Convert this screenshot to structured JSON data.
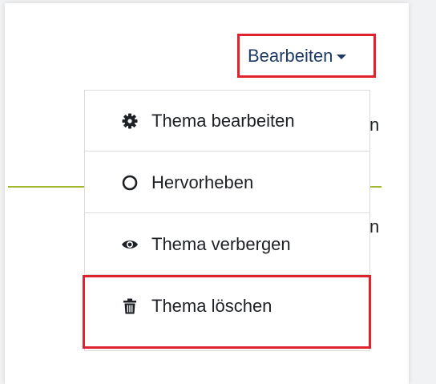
{
  "header": {
    "edit_label": "Bearbeiten"
  },
  "background": {
    "fragment_1": "n",
    "fragment_2": "n"
  },
  "menu": {
    "items": [
      {
        "label": "Thema bearbeiten",
        "icon": "gear-icon"
      },
      {
        "label": "Hervorheben",
        "icon": "circle-outline-icon"
      },
      {
        "label": "Thema verbergen",
        "icon": "eye-icon"
      },
      {
        "label": "Thema löschen",
        "icon": "trash-icon"
      }
    ]
  },
  "colors": {
    "accent": "#1e3b66",
    "highlight_border": "#e0222f",
    "section_line": "#a3b82b"
  }
}
